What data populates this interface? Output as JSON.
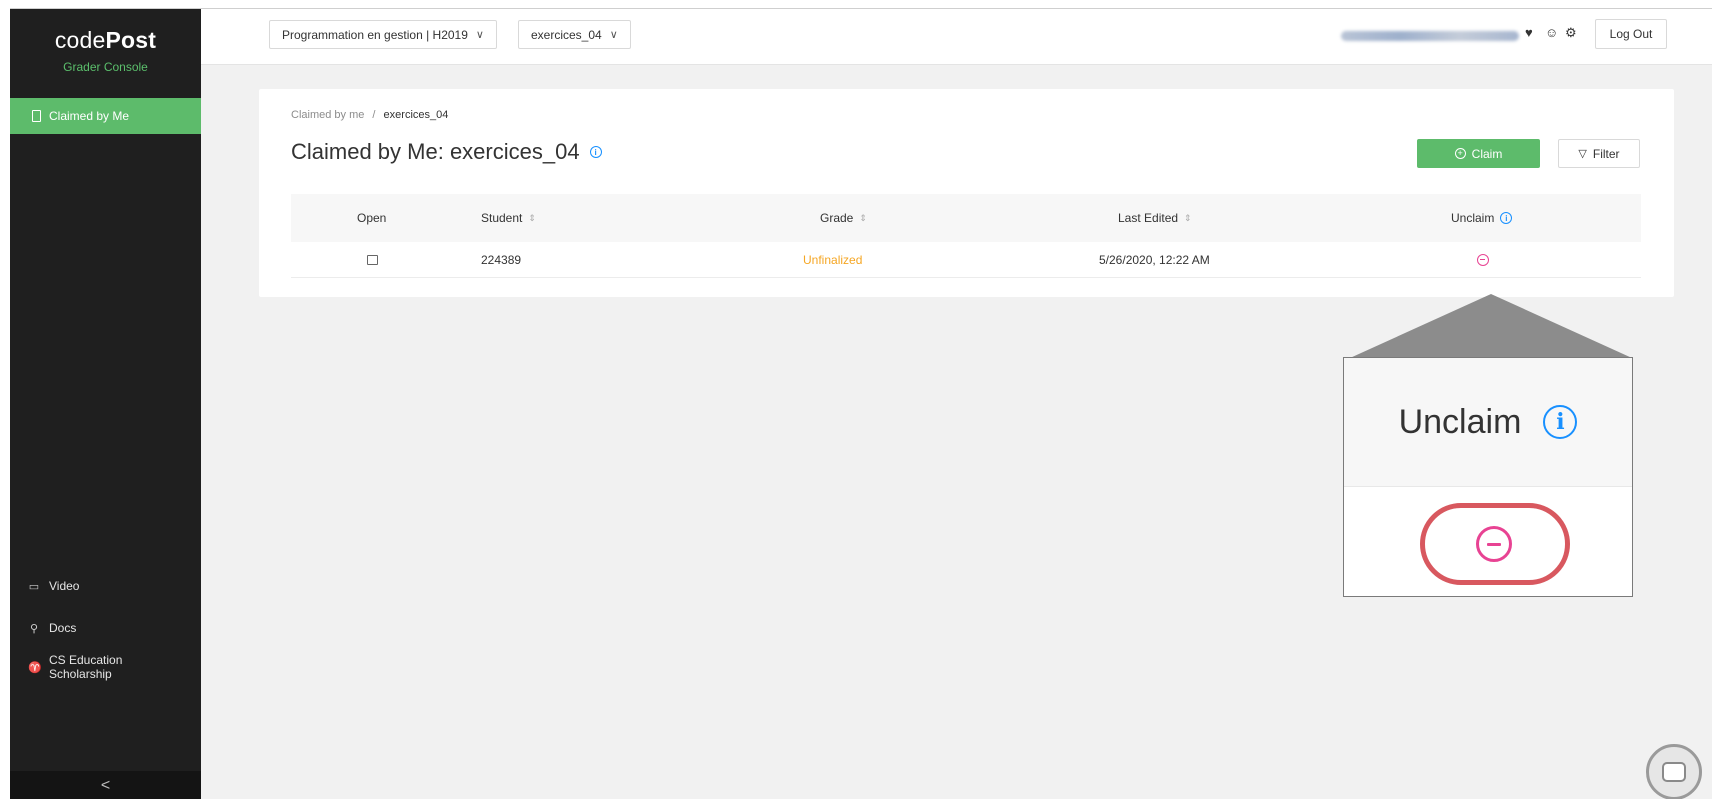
{
  "brand": {
    "name_light": "code",
    "name_bold": "Post",
    "subtitle": "Grader Console"
  },
  "sidebar": {
    "active_item": "Claimed by Me",
    "bottom_links": [
      {
        "label": "Video",
        "icon": "video-icon"
      },
      {
        "label": "Docs",
        "icon": "rocket-icon"
      },
      {
        "label_line1": "CS Education",
        "label_line2": "Scholarship",
        "icon": "trophy-icon"
      }
    ],
    "collapse_glyph": "<"
  },
  "topbar": {
    "course_selector": "Programmation en gestion | H2019",
    "assignment_selector": "exercices_04",
    "logout_label": "Log Out"
  },
  "breadcrumb": {
    "parent": "Claimed by me",
    "separator": "/",
    "current": "exercices_04"
  },
  "page": {
    "title": "Claimed by Me: exercices_04"
  },
  "actions": {
    "claim_label": "Claim",
    "filter_label": "Filter"
  },
  "table": {
    "columns": {
      "open": "Open",
      "student": "Student",
      "grade": "Grade",
      "last_edited": "Last Edited",
      "unclaim": "Unclaim"
    },
    "rows": [
      {
        "student": "224389",
        "grade": "Unfinalized",
        "last_edited": "5/26/2020, 12:22 AM"
      }
    ]
  },
  "callout": {
    "label": "Unclaim"
  },
  "colors": {
    "accent_green": "#5dbb6b",
    "unfinalized": "#f5a623",
    "unclaim_pink": "#e84393",
    "highlight_ring": "#d8585f",
    "info_blue": "#1890ff"
  }
}
